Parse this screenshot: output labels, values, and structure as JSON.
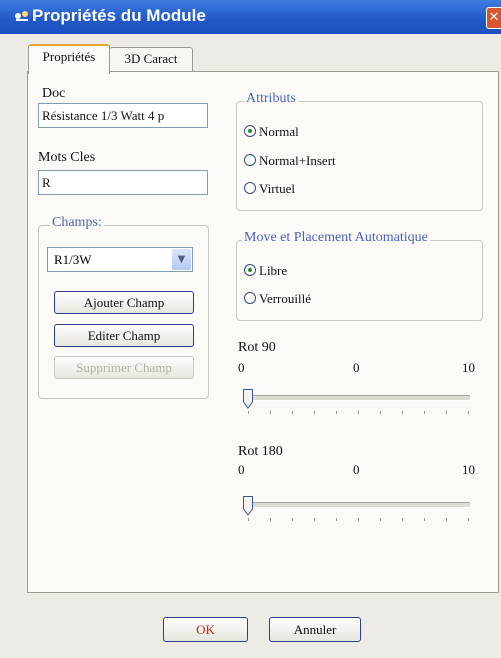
{
  "window": {
    "title": "Propriétés du Module",
    "close_glyph": "✕"
  },
  "tabs": [
    {
      "label": "Propriétés",
      "active": true
    },
    {
      "label": "3D Caract",
      "active": false
    }
  ],
  "doc": {
    "label": "Doc",
    "value": "Résistance 1/3 Watt 4 p"
  },
  "mots_cles": {
    "label": "Mots Cles",
    "value": "R"
  },
  "champs": {
    "legend": "Champs:",
    "selected": "R1/3W",
    "add_label": "Ajouter Champ",
    "edit_label": "Editer Champ",
    "delete_label": "Supprimer Champ"
  },
  "attributs": {
    "legend": "Attributs",
    "options": [
      {
        "label": "Normal",
        "checked": true
      },
      {
        "label": "Normal+Insert",
        "checked": false
      },
      {
        "label": "Virtuel",
        "checked": false
      }
    ]
  },
  "placement": {
    "legend": "Move et Placement Automatique",
    "options": [
      {
        "label": "Libre",
        "checked": true
      },
      {
        "label": "Verrouillé",
        "checked": false
      }
    ]
  },
  "rot90": {
    "label": "Rot 90",
    "min": "0",
    "mid": "0",
    "max": "10",
    "value": 0
  },
  "rot180": {
    "label": "Rot 180",
    "min": "0",
    "mid": "0",
    "max": "10",
    "value": 0
  },
  "footer": {
    "ok_label": "OK",
    "cancel_label": "Annuler"
  },
  "colors": {
    "titlebar": "#2459c9",
    "legend_text": "#4a64b8",
    "ok_text": "#cc2222",
    "radio_dot": "#2a8a2a"
  }
}
